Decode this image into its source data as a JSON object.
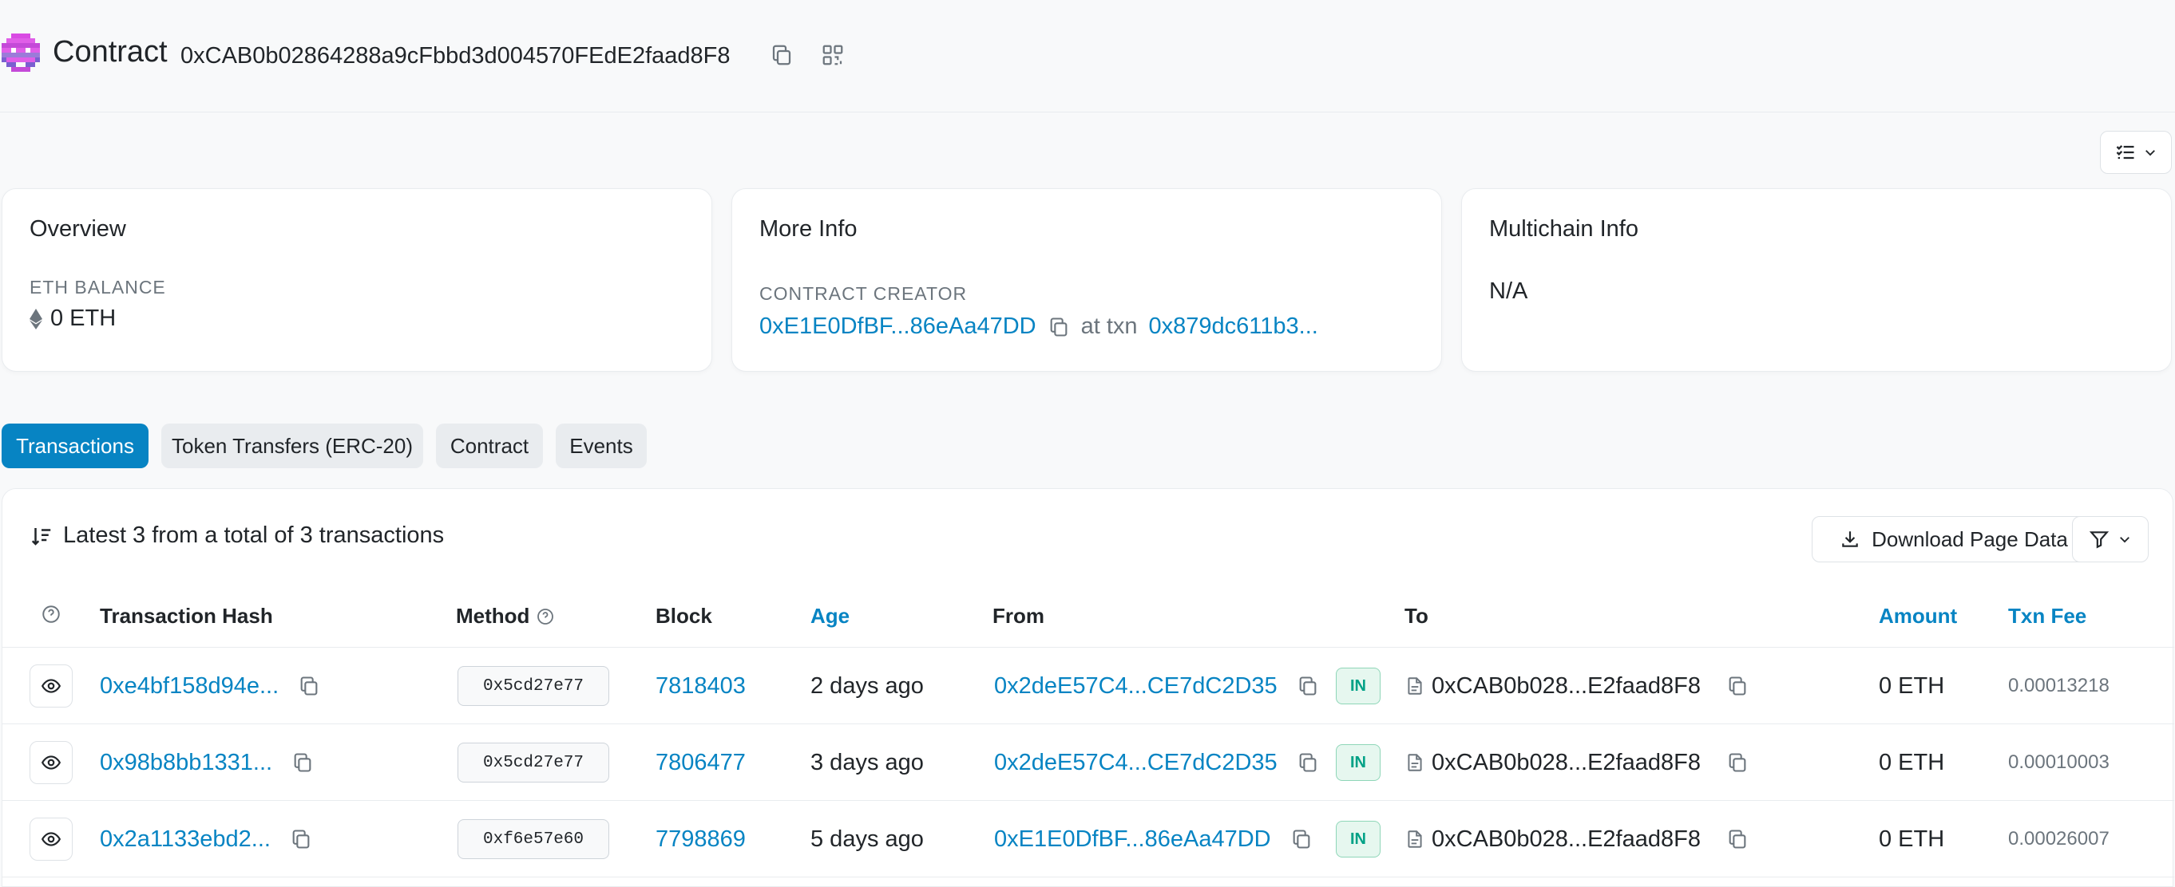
{
  "header": {
    "title": "Contract",
    "address": "0xCAB0b02864288a9cFbbd3d004570FEdE2faad8F8",
    "icons": [
      "avatar-icon",
      "copy-icon",
      "qr-code-icon"
    ]
  },
  "cards": {
    "overview": {
      "title": "Overview",
      "balance_label": "ETH BALANCE",
      "balance_value": "0 ETH"
    },
    "more_info": {
      "title": "More Info",
      "creator_label": "CONTRACT CREATOR",
      "creator_address": "0xE1E0DfBF...86eAa47DD",
      "at_txn_text": "at txn",
      "creator_txn": "0x879dc611b3..."
    },
    "multichain": {
      "title": "Multichain Info",
      "value": "N/A"
    }
  },
  "tabs": [
    {
      "label": "Transactions",
      "active": true
    },
    {
      "label": "Token Transfers (ERC-20)",
      "active": false
    },
    {
      "label": "Contract",
      "active": false
    },
    {
      "label": "Events",
      "active": false
    }
  ],
  "table": {
    "summary": "Latest 3 from a total of 3 transactions",
    "download_label": "Download Page Data",
    "columns": {
      "hash": "Transaction Hash",
      "method": "Method",
      "block": "Block",
      "age": "Age",
      "from": "From",
      "to": "To",
      "amount": "Amount",
      "fee": "Txn Fee"
    },
    "rows": [
      {
        "hash": "0xe4bf158d94e...",
        "method": "0x5cd27e77",
        "block": "7818403",
        "age": "2 days ago",
        "from": "0x2deE57C4...CE7dC2D35",
        "direction": "IN",
        "to": "0xCAB0b028...E2faad8F8",
        "amount": "0 ETH",
        "fee": "0.00013218"
      },
      {
        "hash": "0x98b8bb1331...",
        "method": "0x5cd27e77",
        "block": "7806477",
        "age": "3 days ago",
        "from": "0x2deE57C4...CE7dC2D35",
        "direction": "IN",
        "to": "0xCAB0b028...E2faad8F8",
        "amount": "0 ETH",
        "fee": "0.00010003"
      },
      {
        "hash": "0x2a1133ebd2...",
        "method": "0xf6e57e60",
        "block": "7798869",
        "age": "5 days ago",
        "from": "0xE1E0DfBF...86eAa47DD",
        "direction": "IN",
        "to": "0xCAB0b028...E2faad8F8",
        "amount": "0 ETH",
        "fee": "0.00026007"
      }
    ]
  },
  "colors": {
    "accent": "#0784c3",
    "in_badge": "#00a186",
    "muted": "#6c757d"
  }
}
